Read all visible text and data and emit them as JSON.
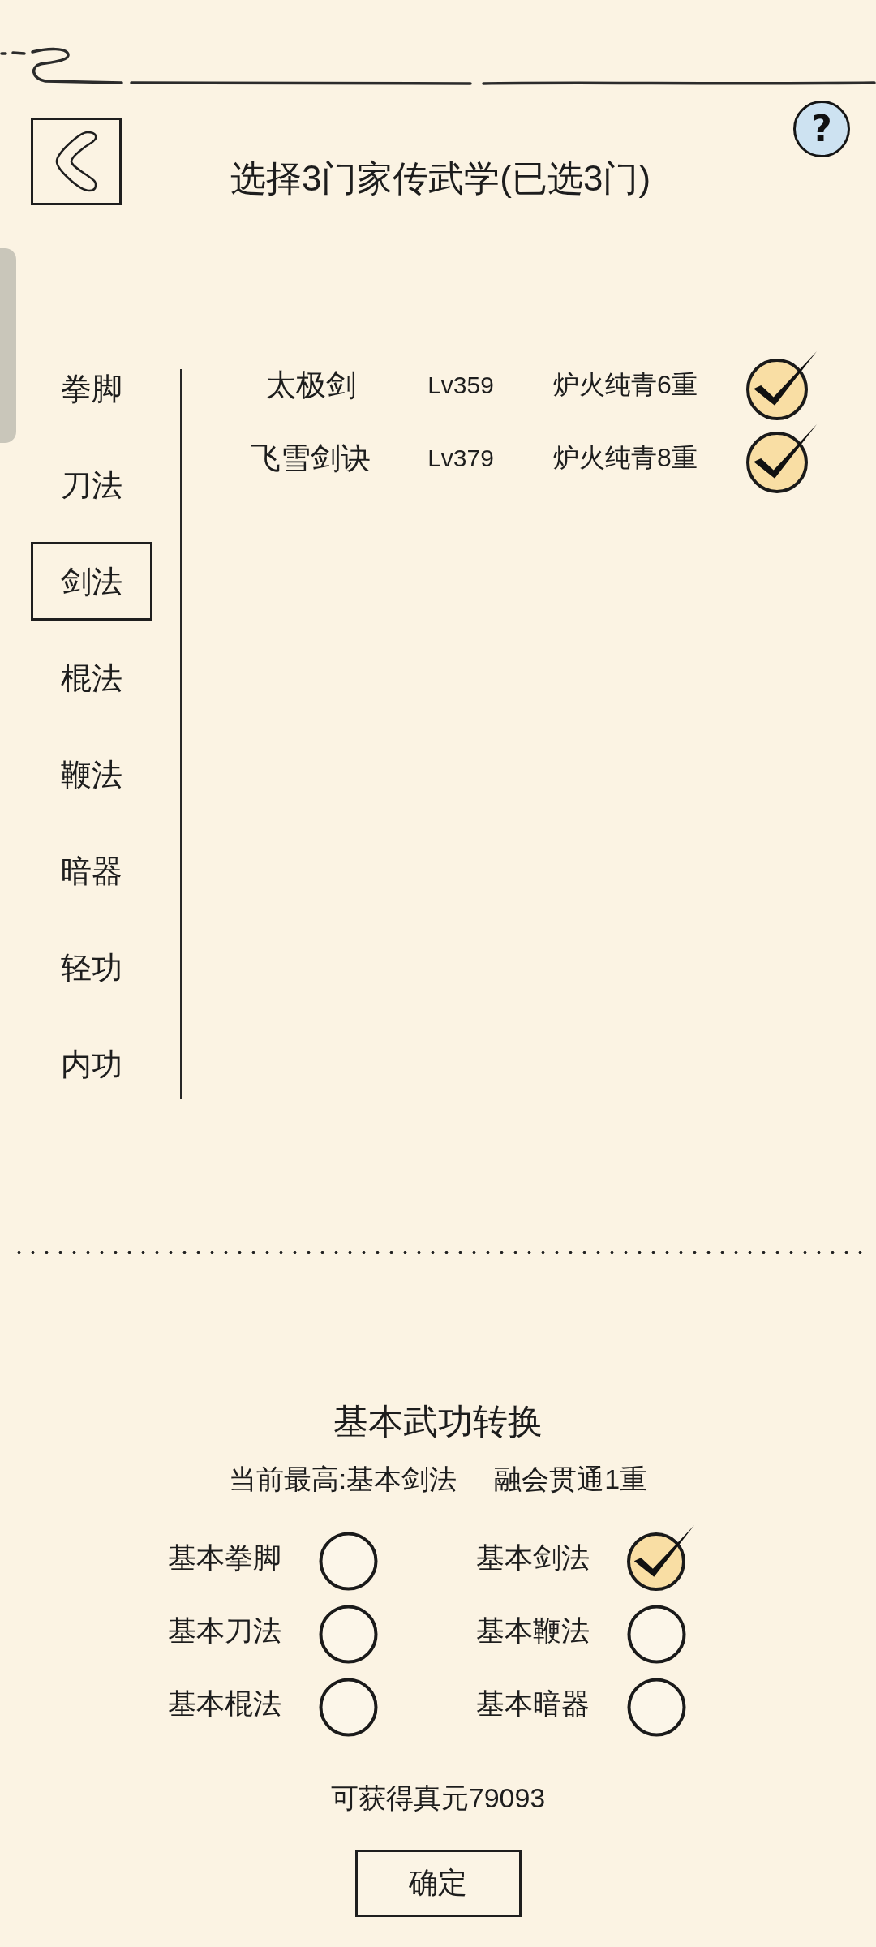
{
  "header": {
    "title": "选择3门家传武学(已选3门)",
    "help_label": "?"
  },
  "categories": [
    {
      "label": "拳脚",
      "selected": false
    },
    {
      "label": "刀法",
      "selected": false
    },
    {
      "label": "剑法",
      "selected": true
    },
    {
      "label": "棍法",
      "selected": false
    },
    {
      "label": "鞭法",
      "selected": false
    },
    {
      "label": "暗器",
      "selected": false
    },
    {
      "label": "轻功",
      "selected": false
    },
    {
      "label": "内功",
      "selected": false
    }
  ],
  "skills": [
    {
      "name": "太极剑",
      "level_text": "Lv359",
      "rank": "炉火纯青6重",
      "checked": true
    },
    {
      "name": "飞雪剑诀",
      "level_text": "Lv379",
      "rank": "炉火纯青8重",
      "checked": true
    }
  ],
  "conversion": {
    "title": "基本武功转换",
    "current_best": "当前最高:基本剑法",
    "mastery": "融会贯通1重",
    "options": [
      {
        "label": "基本拳脚",
        "checked": false
      },
      {
        "label": "基本剑法",
        "checked": true
      },
      {
        "label": "基本刀法",
        "checked": false
      },
      {
        "label": "基本鞭法",
        "checked": false
      },
      {
        "label": "基本棍法",
        "checked": false
      },
      {
        "label": "基本暗器",
        "checked": false
      }
    ]
  },
  "reward": "可获得真元79093",
  "confirm_button": "确定"
}
